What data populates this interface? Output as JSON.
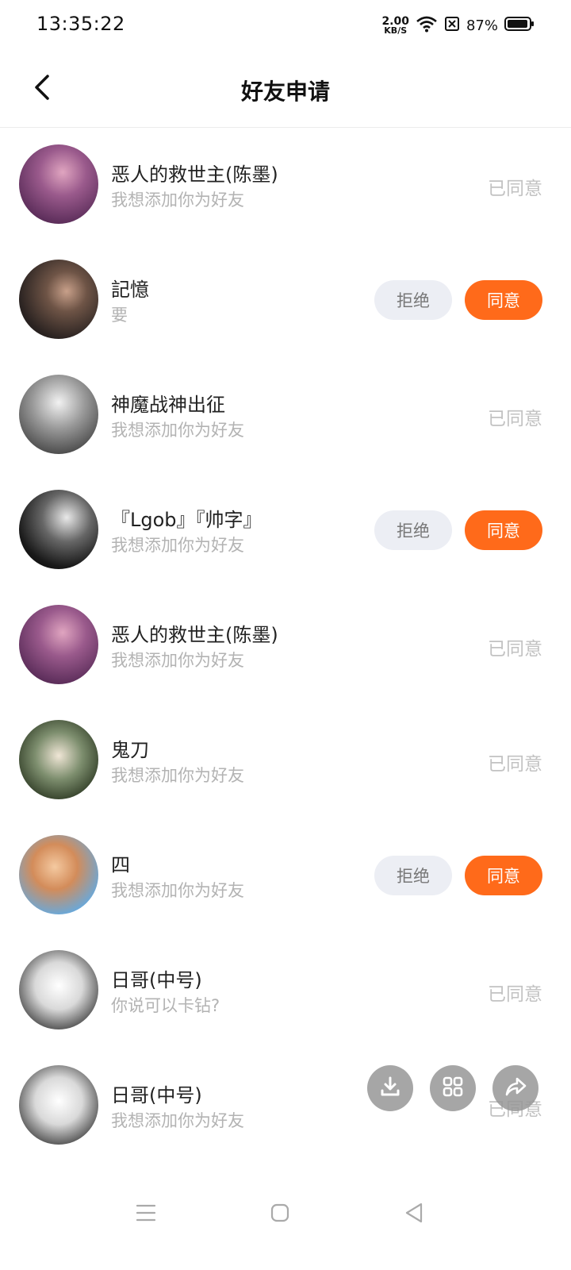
{
  "status_bar": {
    "time": "13:35:22",
    "net_speed": "2.00",
    "net_unit": "KB/S",
    "battery": "87%"
  },
  "header": {
    "title": "好友申请"
  },
  "labels": {
    "agreed": "已同意",
    "reject": "拒绝",
    "accept": "同意"
  },
  "requests": [
    {
      "name": "恶人的救世主(陈墨)",
      "message": "我想添加你为好友",
      "status": "agreed"
    },
    {
      "name": "記憶",
      "message": "要",
      "status": "pending"
    },
    {
      "name": "神魔战神出征",
      "message": "我想添加你为好友",
      "status": "agreed"
    },
    {
      "name": "『Lgob』『帅字』",
      "message": "我想添加你为好友",
      "status": "pending"
    },
    {
      "name": "恶人的救世主(陈墨)",
      "message": "我想添加你为好友",
      "status": "agreed"
    },
    {
      "name": "鬼刀",
      "message": "我想添加你为好友",
      "status": "agreed"
    },
    {
      "name": "四",
      "message": "我想添加你为好友",
      "status": "pending"
    },
    {
      "name": "日哥(中号)",
      "message": "你说可以卡钻?",
      "status": "agreed"
    },
    {
      "name": "日哥(中号)",
      "message": "我想添加你为好友",
      "status": "agreed"
    }
  ],
  "colors": {
    "accent": "#ff6a1a",
    "reject_bg": "#eceef4",
    "muted_text": "#b3b3b3"
  },
  "icons": {
    "back": "chevron-left-icon",
    "download": "download-icon",
    "grid": "grid-icon",
    "share": "share-icon"
  }
}
